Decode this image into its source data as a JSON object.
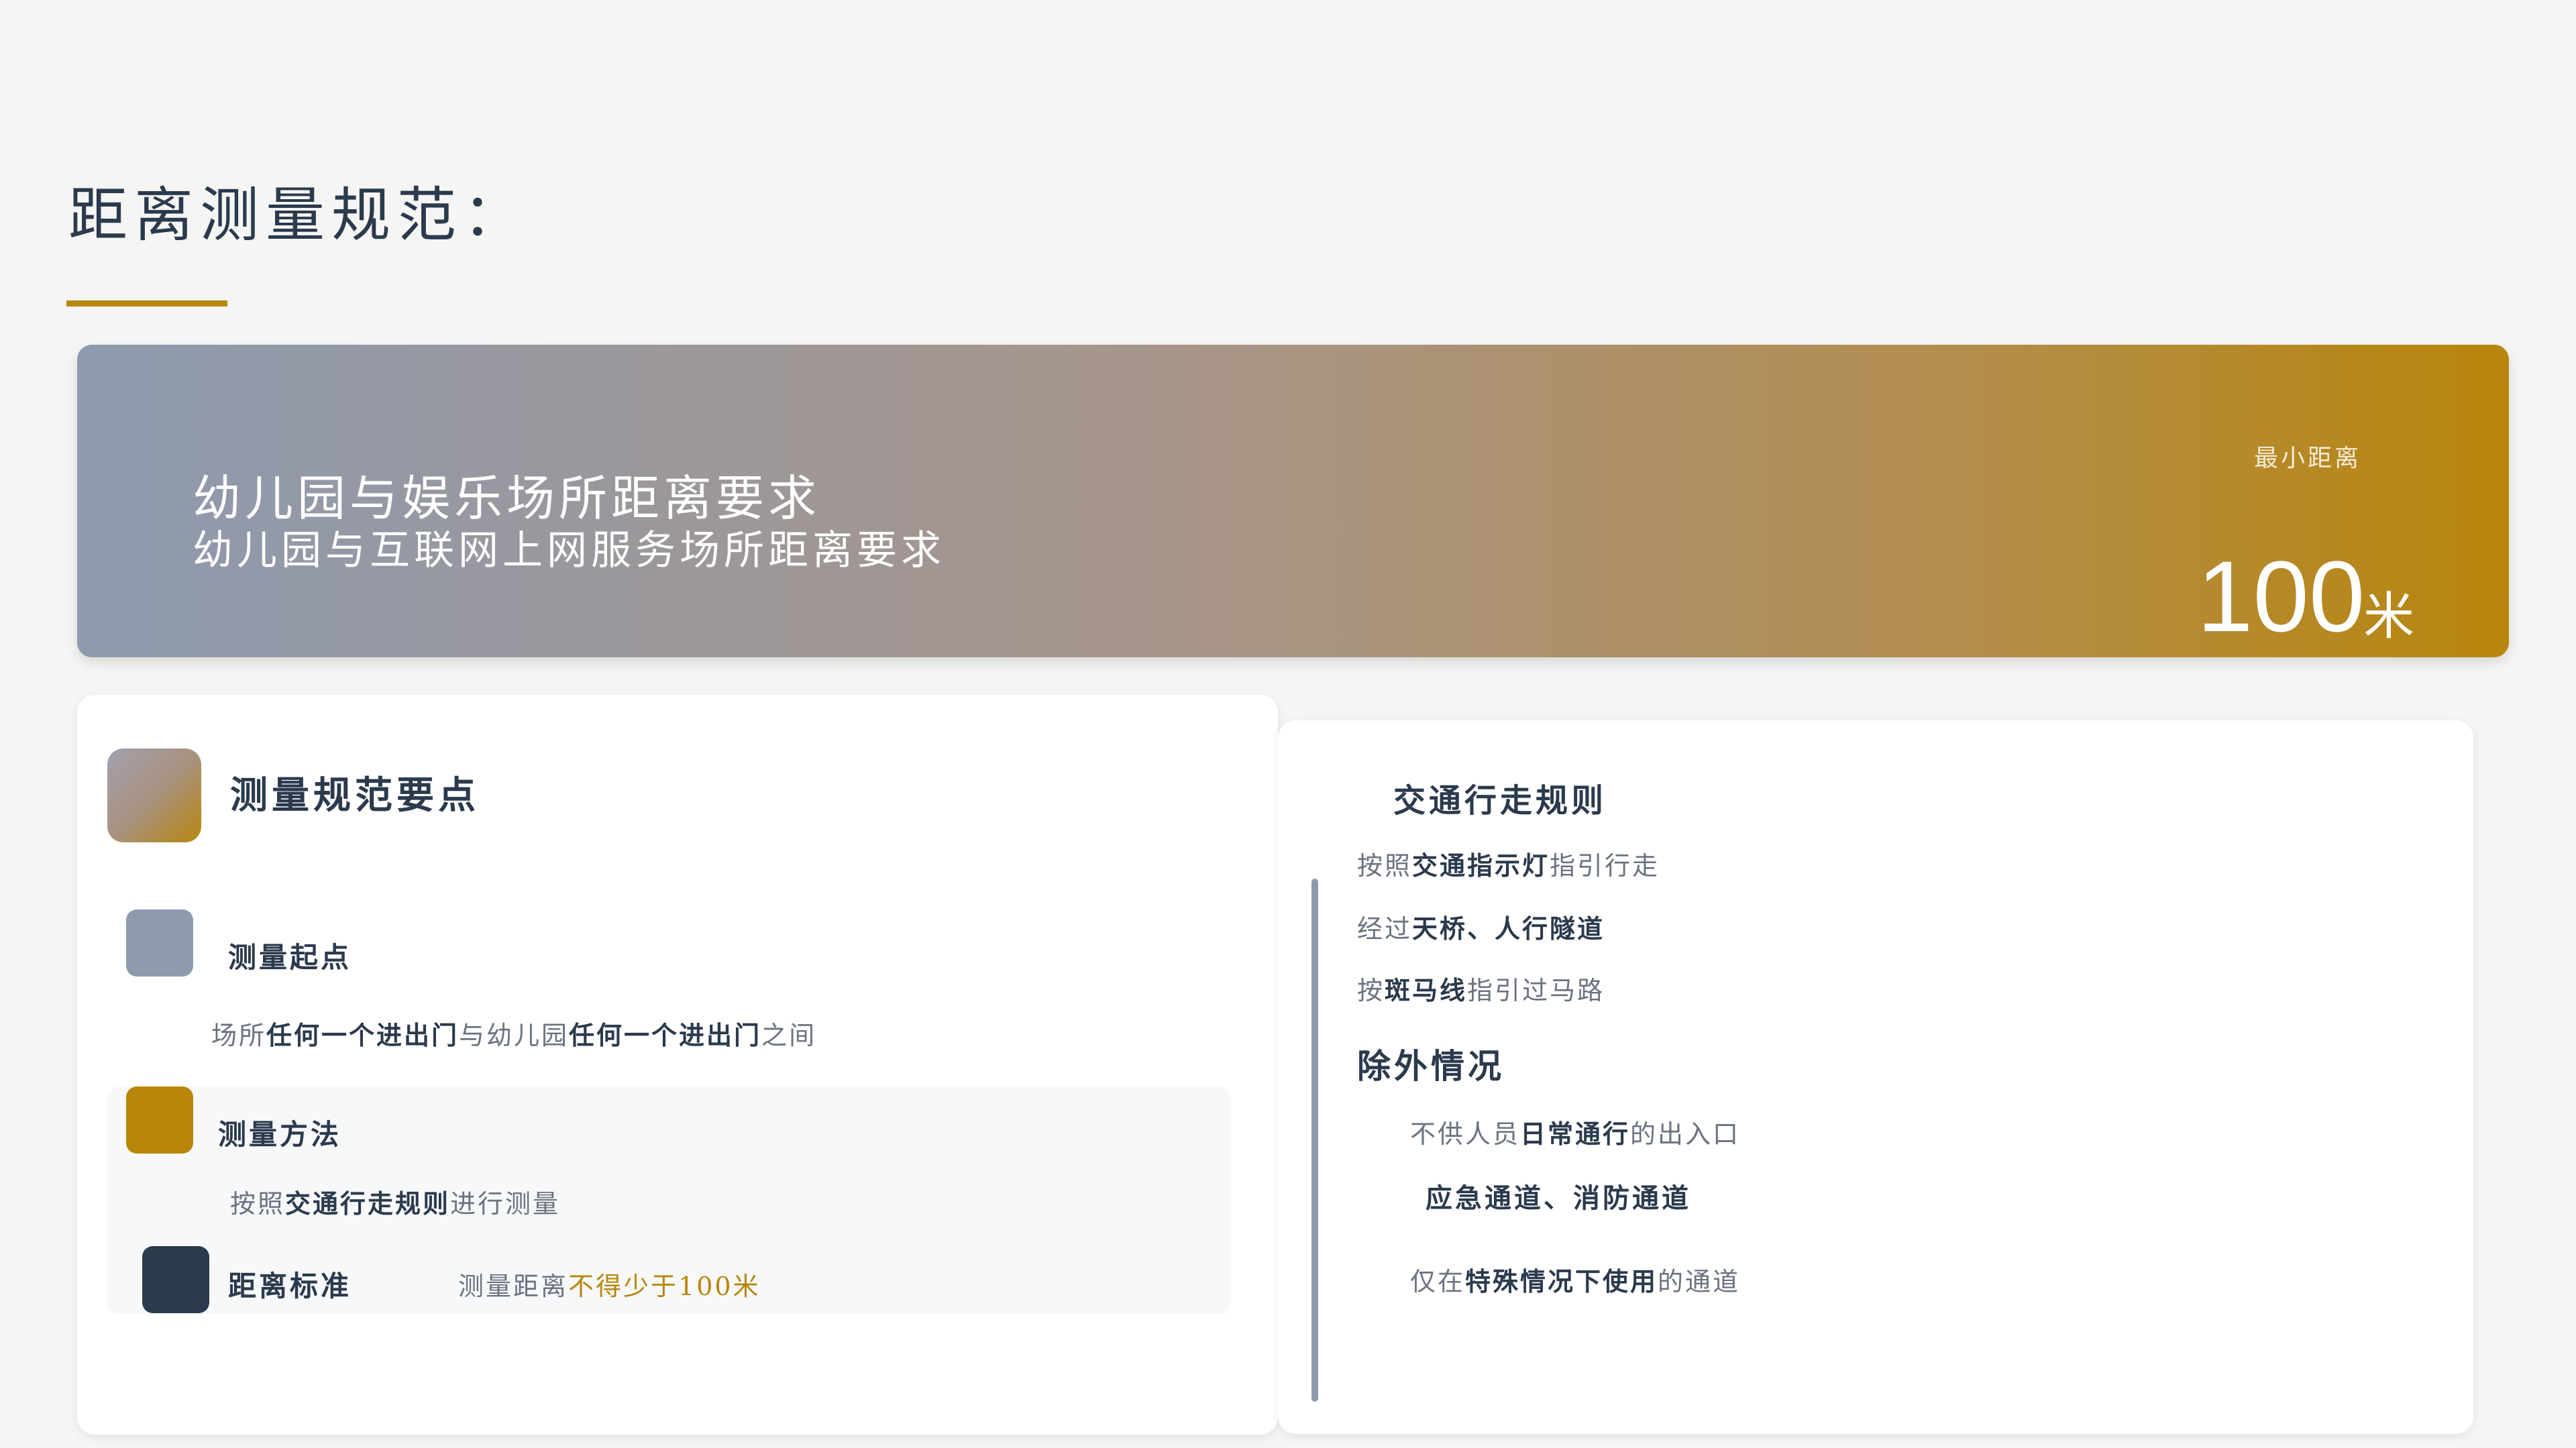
{
  "page": {
    "title": "距离测量规范："
  },
  "hero": {
    "line1": "幼儿园与娱乐场所距离要求",
    "line2": "幼儿园与互联网上网服务场所距离要求",
    "min_label": "最小距离",
    "value": "100",
    "unit": "米"
  },
  "left_card": {
    "heading": "测量规范要点",
    "items": [
      {
        "title": "测量起点",
        "desc": {
          "p1": "场所",
          "b1": "任何一个进出门",
          "p2": "与幼儿园",
          "b2": "任何一个进出门",
          "p3": "之间"
        }
      },
      {
        "title": "测量方法",
        "desc": {
          "p1": "按照",
          "b1": "交通行走规则",
          "p2": "进行测量"
        }
      },
      {
        "title": "距离标准",
        "desc": {
          "p1": "测量距离",
          "hl": "不得少于100米"
        }
      }
    ]
  },
  "right_card": {
    "heading": "交通行走规则",
    "rules": [
      {
        "p1": "按照",
        "b1": "交通指示灯",
        "p2": "指引行走"
      },
      {
        "p1": "经过",
        "b1": "天桥、人行隧道",
        "p2": ""
      },
      {
        "p1": "按",
        "b1": "斑马线",
        "p2": "指引过马路"
      }
    ],
    "exceptions_heading": "除外情况",
    "exception1": {
      "p1": "不供人员",
      "b1": "日常通行",
      "p2": "的出入口"
    },
    "exception_strong": "应急通道、消防通道",
    "exception2": {
      "p1": "仅在",
      "b1": "特殊情况下使用",
      "p2": "的通道"
    }
  },
  "colors": {
    "accent": "#b8860b",
    "slate": "#8e9aae",
    "navy": "#2b3a4d"
  }
}
